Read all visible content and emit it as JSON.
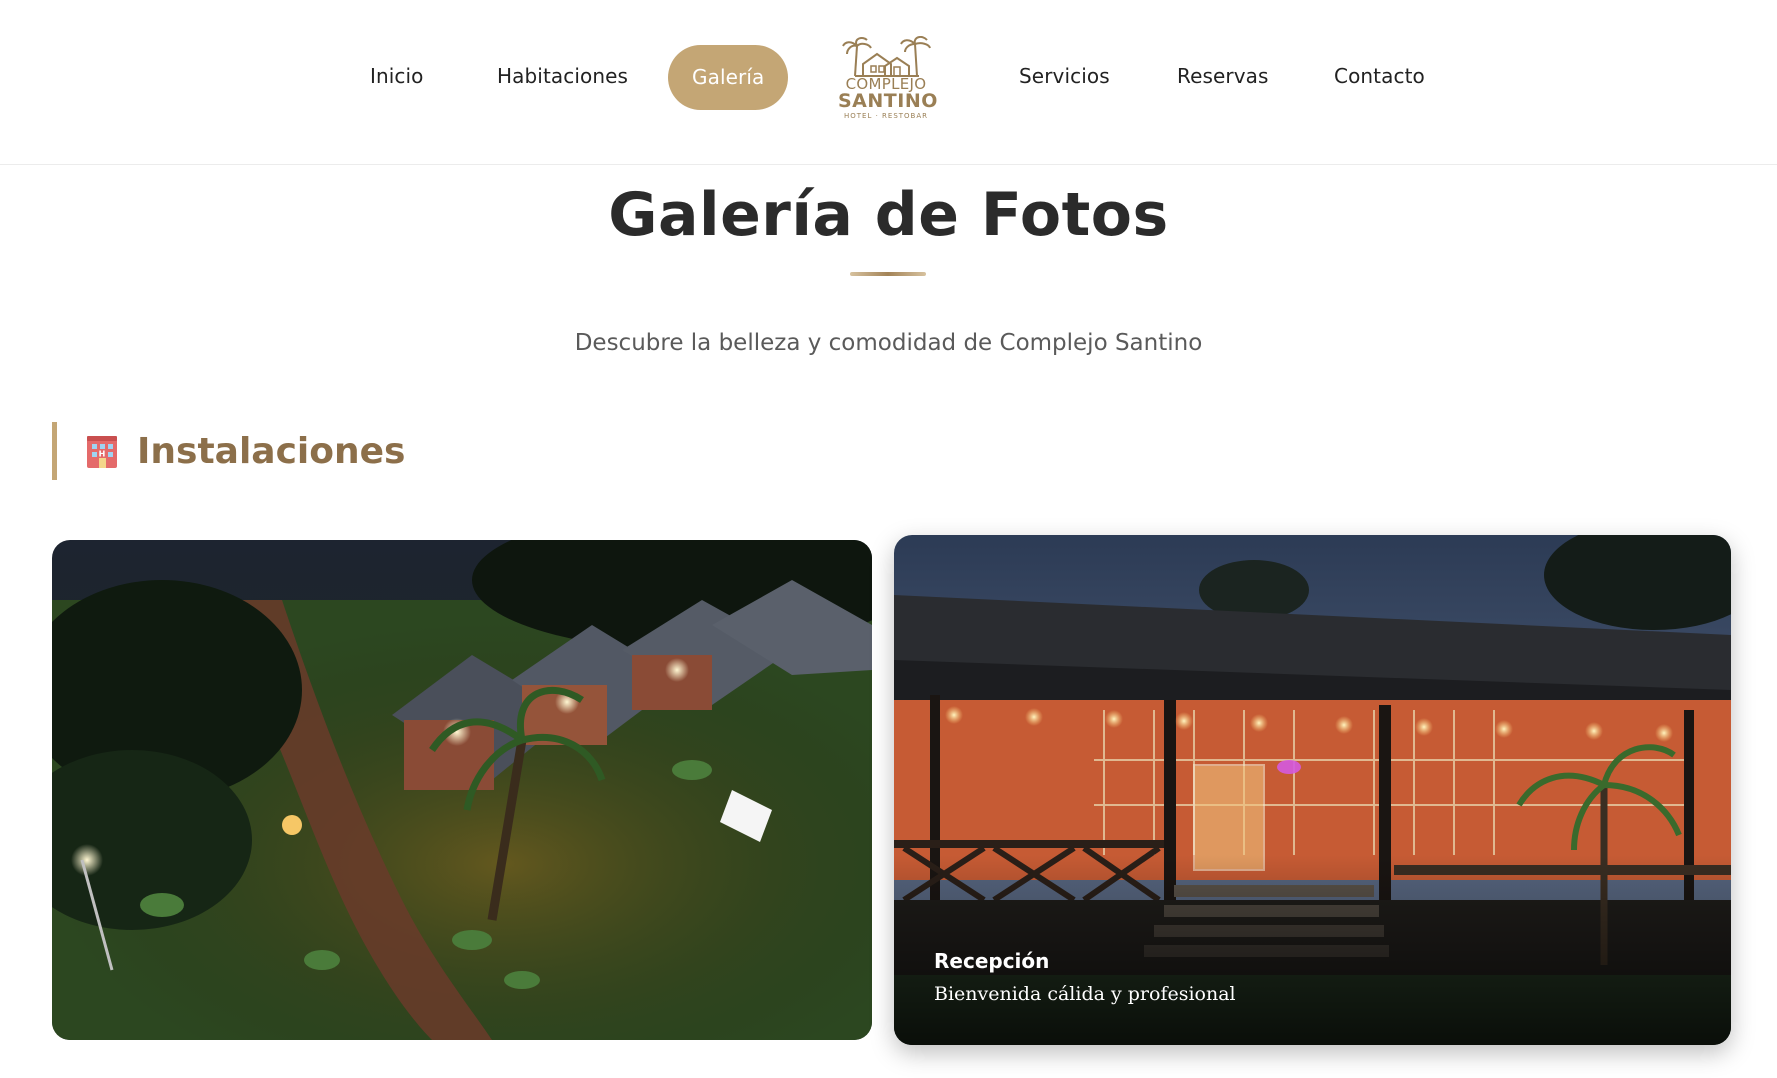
{
  "nav": {
    "items": [
      {
        "label": "Inicio"
      },
      {
        "label": "Habitaciones"
      },
      {
        "label": "Galería",
        "active": true
      },
      {
        "label": "Servicios"
      },
      {
        "label": "Reservas"
      },
      {
        "label": "Contacto"
      }
    ]
  },
  "logo": {
    "line1": "COMPLEJO",
    "line2": "SANTINO",
    "line3": "HOTEL · RESTOBAR"
  },
  "header": {
    "title": "Galería de Fotos",
    "subtitle": "Descubre la belleza y comodidad de Complejo Santino"
  },
  "section": {
    "icon": "hotel-icon",
    "title": "Instalaciones"
  },
  "gallery": [
    {
      "title": "",
      "description": ""
    },
    {
      "title": "Recepción",
      "description": "Bienvenida cálida y profesional"
    }
  ],
  "colors": {
    "accent": "#c4a675",
    "section_title": "#8c6f4a",
    "text": "#2b2b2b"
  }
}
